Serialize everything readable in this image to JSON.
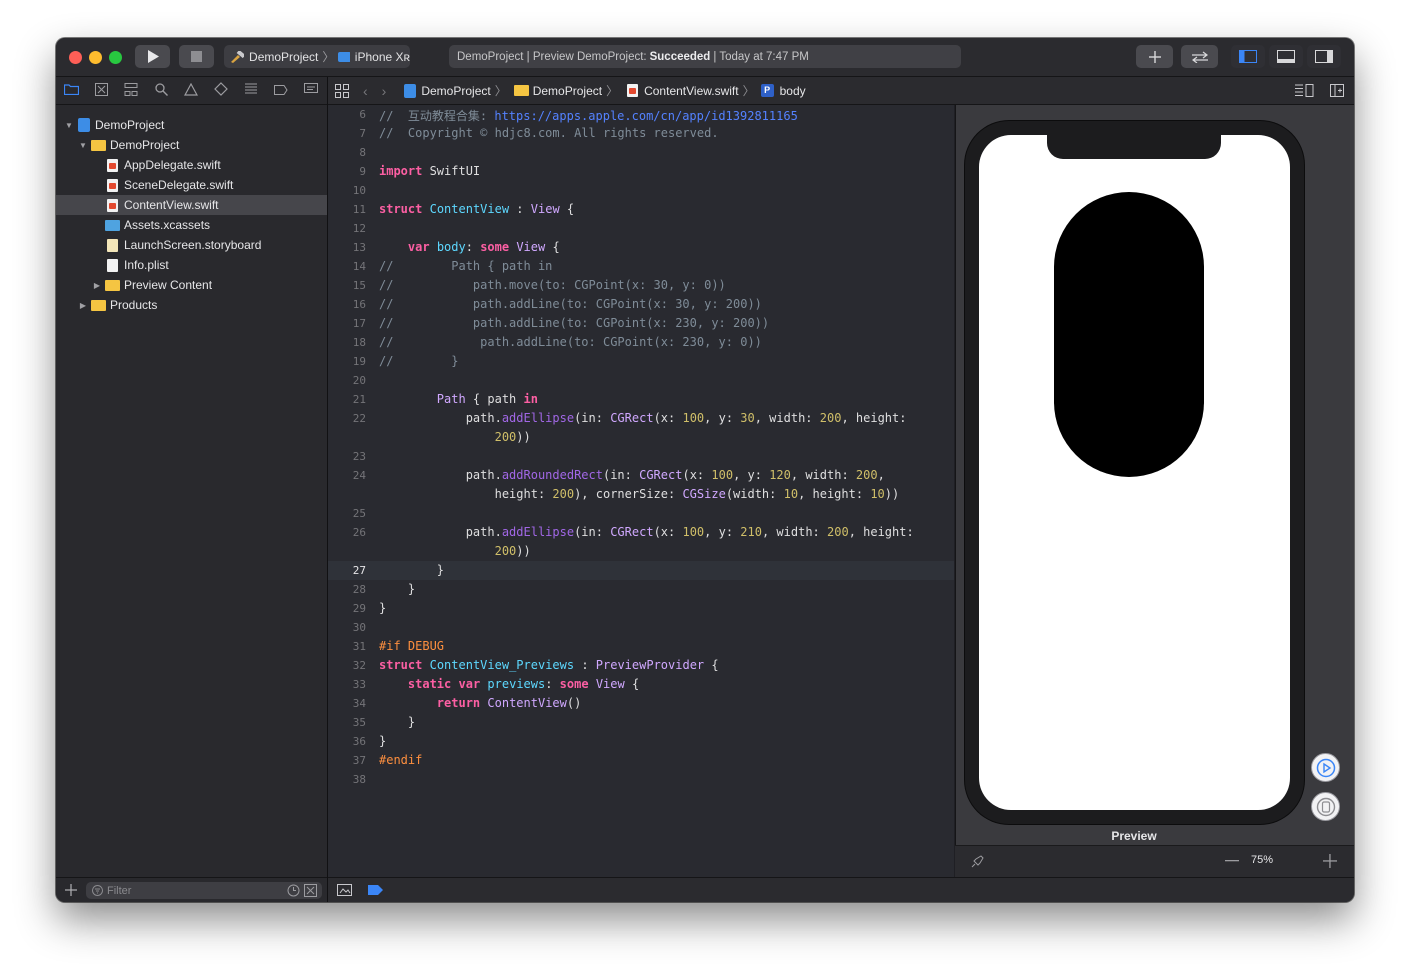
{
  "window": {
    "scheme_project": "DemoProject",
    "scheme_device": "iPhone Xʀ",
    "activity": {
      "prefix": "DemoProject | Preview DemoProject:",
      "status": "Succeeded",
      "suffix": "| Today at 7:47 PM"
    }
  },
  "navigator": {
    "items": [
      {
        "label": "DemoProject",
        "kind": "project",
        "depth": 0,
        "disclosure": "open"
      },
      {
        "label": "DemoProject",
        "kind": "folder",
        "depth": 1,
        "disclosure": "open"
      },
      {
        "label": "AppDelegate.swift",
        "kind": "swift",
        "depth": 2
      },
      {
        "label": "SceneDelegate.swift",
        "kind": "swift",
        "depth": 2
      },
      {
        "label": "ContentView.swift",
        "kind": "swift",
        "depth": 2,
        "selected": true
      },
      {
        "label": "Assets.xcassets",
        "kind": "assets",
        "depth": 2
      },
      {
        "label": "LaunchScreen.storyboard",
        "kind": "storyboard",
        "depth": 2
      },
      {
        "label": "Info.plist",
        "kind": "plist",
        "depth": 2
      },
      {
        "label": "Preview Content",
        "kind": "folder",
        "depth": 2,
        "disclosure": "closed"
      },
      {
        "label": "Products",
        "kind": "folder",
        "depth": 1,
        "disclosure": "closed"
      }
    ],
    "filter_placeholder": "Filter"
  },
  "jumpbar": {
    "crumbs": [
      "DemoProject",
      "DemoProject",
      "ContentView.swift",
      "body"
    ]
  },
  "editor": {
    "current_line": 27,
    "lines": [
      {
        "n": "6",
        "t": [
          [
            "cm",
            "//  互动教程合集: "
          ],
          [
            "url",
            "https://apps.apple.com/cn/app/id1392811165"
          ]
        ]
      },
      {
        "n": "7",
        "t": [
          [
            "cm",
            "//  Copyright © hdjc8.com. All rights reserved."
          ]
        ]
      },
      {
        "n": "8",
        "t": []
      },
      {
        "n": "9",
        "t": [
          [
            "kw",
            "import"
          ],
          [
            "plain",
            " SwiftUI"
          ]
        ]
      },
      {
        "n": "10",
        "t": []
      },
      {
        "n": "11",
        "t": [
          [
            "kw",
            "struct"
          ],
          [
            "plain",
            " "
          ],
          [
            "ty",
            "ContentView"
          ],
          [
            "plain",
            " : "
          ],
          [
            "tp",
            "View"
          ],
          [
            "plain",
            " {"
          ]
        ]
      },
      {
        "n": "12",
        "t": []
      },
      {
        "n": "13",
        "t": [
          [
            "plain",
            "    "
          ],
          [
            "kw",
            "var"
          ],
          [
            "plain",
            " "
          ],
          [
            "ty",
            "body"
          ],
          [
            "plain",
            ": "
          ],
          [
            "kw",
            "some"
          ],
          [
            "plain",
            " "
          ],
          [
            "tp",
            "View"
          ],
          [
            "plain",
            " {"
          ]
        ]
      },
      {
        "n": "14",
        "t": [
          [
            "cm",
            "//        Path { path in"
          ]
        ]
      },
      {
        "n": "15",
        "t": [
          [
            "cm",
            "//           path.move(to: CGPoint(x: 30, y: 0))"
          ]
        ]
      },
      {
        "n": "16",
        "t": [
          [
            "cm",
            "//           path.addLine(to: CGPoint(x: 30, y: 200))"
          ]
        ]
      },
      {
        "n": "17",
        "t": [
          [
            "cm",
            "//           path.addLine(to: CGPoint(x: 230, y: 200))"
          ]
        ]
      },
      {
        "n": "18",
        "t": [
          [
            "cm",
            "//            path.addLine(to: CGPoint(x: 230, y: 0))"
          ]
        ]
      },
      {
        "n": "19",
        "t": [
          [
            "cm",
            "//        }"
          ]
        ]
      },
      {
        "n": "20",
        "t": []
      },
      {
        "n": "21",
        "t": [
          [
            "plain",
            "        "
          ],
          [
            "tp",
            "Path"
          ],
          [
            "plain",
            " { path "
          ],
          [
            "kw",
            "in"
          ]
        ]
      },
      {
        "n": "22",
        "t": [
          [
            "plain",
            "            path."
          ],
          [
            "fn",
            "addEllipse"
          ],
          [
            "plain",
            "(in: "
          ],
          [
            "tp",
            "CGRect"
          ],
          [
            "plain",
            "(x: "
          ],
          [
            "num",
            "100"
          ],
          [
            "plain",
            ", y: "
          ],
          [
            "num",
            "30"
          ],
          [
            "plain",
            ", width: "
          ],
          [
            "num",
            "200"
          ],
          [
            "plain",
            ", height:"
          ]
        ]
      },
      {
        "n": "",
        "t": [
          [
            "plain",
            "                "
          ],
          [
            "num",
            "200"
          ],
          [
            "plain",
            "))"
          ]
        ]
      },
      {
        "n": "23",
        "t": []
      },
      {
        "n": "24",
        "t": [
          [
            "plain",
            "            path."
          ],
          [
            "fn",
            "addRoundedRect"
          ],
          [
            "plain",
            "(in: "
          ],
          [
            "tp",
            "CGRect"
          ],
          [
            "plain",
            "(x: "
          ],
          [
            "num",
            "100"
          ],
          [
            "plain",
            ", y: "
          ],
          [
            "num",
            "120"
          ],
          [
            "plain",
            ", width: "
          ],
          [
            "num",
            "200"
          ],
          [
            "plain",
            ","
          ]
        ]
      },
      {
        "n": "",
        "t": [
          [
            "plain",
            "                height: "
          ],
          [
            "num",
            "200"
          ],
          [
            "plain",
            "), cornerSize: "
          ],
          [
            "tp",
            "CGSize"
          ],
          [
            "plain",
            "(width: "
          ],
          [
            "num",
            "10"
          ],
          [
            "plain",
            ", height: "
          ],
          [
            "num",
            "10"
          ],
          [
            "plain",
            "))"
          ]
        ]
      },
      {
        "n": "25",
        "t": []
      },
      {
        "n": "26",
        "t": [
          [
            "plain",
            "            path."
          ],
          [
            "fn",
            "addEllipse"
          ],
          [
            "plain",
            "(in: "
          ],
          [
            "tp",
            "CGRect"
          ],
          [
            "plain",
            "(x: "
          ],
          [
            "num",
            "100"
          ],
          [
            "plain",
            ", y: "
          ],
          [
            "num",
            "210"
          ],
          [
            "plain",
            ", width: "
          ],
          [
            "num",
            "200"
          ],
          [
            "plain",
            ", height:"
          ]
        ]
      },
      {
        "n": "",
        "t": [
          [
            "plain",
            "                "
          ],
          [
            "num",
            "200"
          ],
          [
            "plain",
            "))"
          ]
        ]
      },
      {
        "n": "27",
        "t": [
          [
            "plain",
            "        }"
          ]
        ]
      },
      {
        "n": "28",
        "t": [
          [
            "plain",
            "    }"
          ]
        ]
      },
      {
        "n": "29",
        "t": [
          [
            "plain",
            "}"
          ]
        ]
      },
      {
        "n": "30",
        "t": []
      },
      {
        "n": "31",
        "t": [
          [
            "pp",
            "#if DEBUG"
          ]
        ]
      },
      {
        "n": "32",
        "t": [
          [
            "kw",
            "struct"
          ],
          [
            "plain",
            " "
          ],
          [
            "ty",
            "ContentView_Previews"
          ],
          [
            "plain",
            " : "
          ],
          [
            "tp",
            "PreviewProvider"
          ],
          [
            "plain",
            " {"
          ]
        ]
      },
      {
        "n": "33",
        "t": [
          [
            "plain",
            "    "
          ],
          [
            "kw",
            "static"
          ],
          [
            "plain",
            " "
          ],
          [
            "kw",
            "var"
          ],
          [
            "plain",
            " "
          ],
          [
            "ty",
            "previews"
          ],
          [
            "plain",
            ": "
          ],
          [
            "kw",
            "some"
          ],
          [
            "plain",
            " "
          ],
          [
            "tp",
            "View"
          ],
          [
            "plain",
            " {"
          ]
        ]
      },
      {
        "n": "34",
        "t": [
          [
            "plain",
            "        "
          ],
          [
            "kw",
            "return"
          ],
          [
            "plain",
            " "
          ],
          [
            "tp",
            "ContentView"
          ],
          [
            "plain",
            "()"
          ]
        ]
      },
      {
        "n": "35",
        "t": [
          [
            "plain",
            "    }"
          ]
        ]
      },
      {
        "n": "36",
        "t": [
          [
            "plain",
            "}"
          ]
        ]
      },
      {
        "n": "37",
        "t": [
          [
            "pp",
            "#endif"
          ]
        ]
      },
      {
        "n": "38",
        "t": []
      }
    ]
  },
  "canvas": {
    "preview_label": "Preview",
    "zoom": "75%",
    "shape_color": "#000000"
  },
  "colors": {
    "close": "#fe5f57",
    "minimize": "#febc2e",
    "zoom": "#28c840",
    "accent": "#3b86f7"
  }
}
